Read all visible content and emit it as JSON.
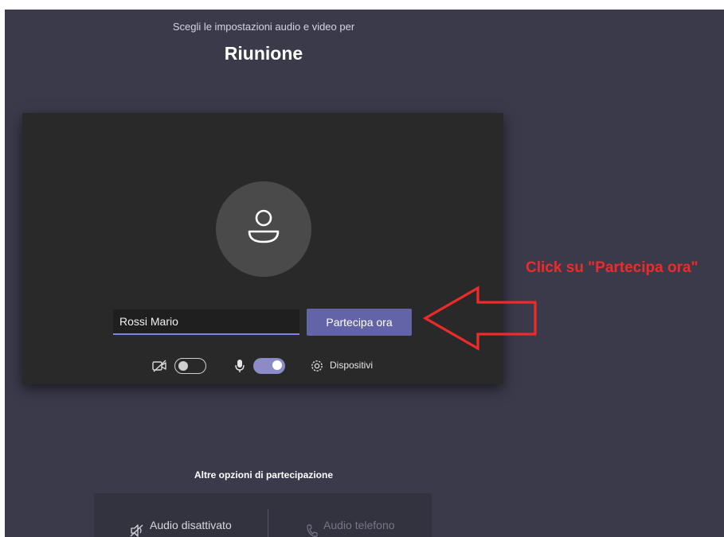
{
  "header": {
    "subtitle": "Scegli le impostazioni audio e video per",
    "title": "Riunione"
  },
  "prejoin": {
    "name_value": "Rossi Mario",
    "join_label": "Partecipa ora",
    "camera_on": false,
    "mic_on": true,
    "devices_label": "Dispositivi"
  },
  "other_options": {
    "label": "Altre opzioni di partecipazione",
    "audio_off_label": "Audio disattivato",
    "phone_label": "Audio telefono"
  },
  "annotation": {
    "text": "Click su \"Partecipa ora\"",
    "color": "#ee2b2b"
  },
  "colors": {
    "background": "#3b3a4b",
    "preview": "#292929",
    "accent": "#6264a7",
    "toggle_on": "#8b8cc7"
  },
  "icons": [
    "person-icon",
    "camera-off-icon",
    "microphone-icon",
    "gear-icon",
    "speaker-off-icon",
    "phone-icon",
    "arrow-annotation-icon"
  ]
}
